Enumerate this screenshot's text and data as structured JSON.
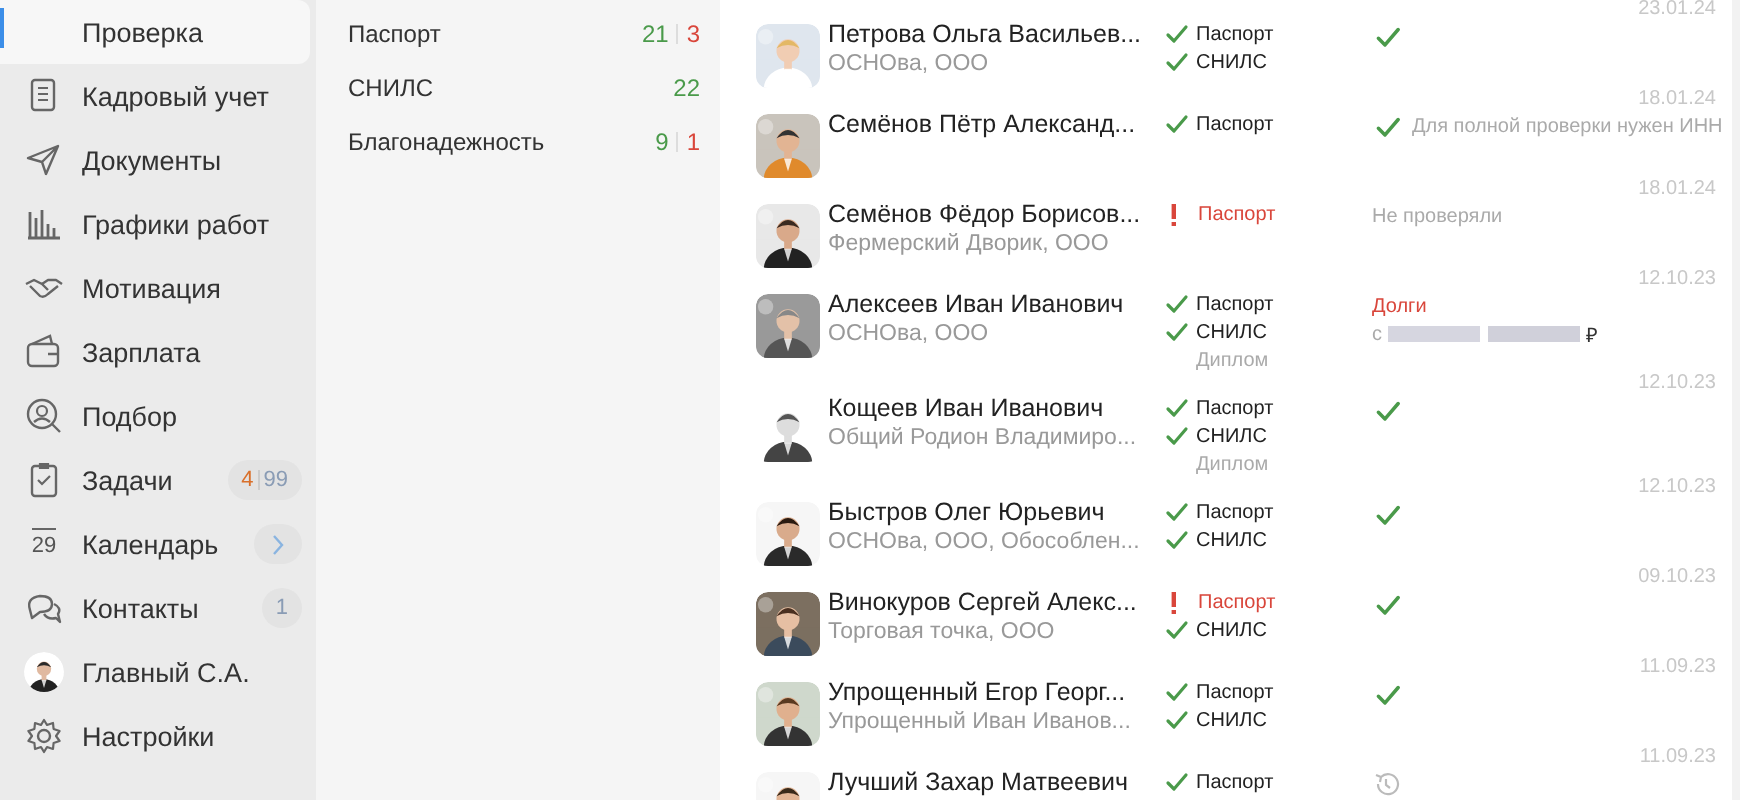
{
  "sidebar": {
    "items": [
      {
        "kind": "nav",
        "label": "Проверка",
        "selected": true
      },
      {
        "kind": "nav",
        "label": "Кадровый учет",
        "selected": false
      },
      {
        "kind": "nav",
        "label": "Документы",
        "selected": false
      },
      {
        "kind": "nav",
        "label": "Графики работ",
        "selected": false
      },
      {
        "kind": "nav",
        "label": "Мотивация",
        "selected": false
      },
      {
        "kind": "nav",
        "label": "Зарплата",
        "selected": false
      },
      {
        "kind": "nav",
        "label": "Подбор",
        "selected": false
      },
      {
        "kind": "nav",
        "label": "Задачи",
        "selected": false,
        "badge": {
          "count": "4",
          "total": "99"
        }
      },
      {
        "kind": "nav",
        "label": "Календарь",
        "selected": false,
        "icon_text": "29",
        "arrow": true
      },
      {
        "kind": "nav",
        "label": "Контакты",
        "selected": false,
        "badge": {
          "total": "1"
        }
      },
      {
        "kind": "profile",
        "label": "Главный С.А.",
        "selected": false
      },
      {
        "kind": "nav",
        "label": "Настройки",
        "selected": false
      }
    ]
  },
  "filters": [
    {
      "label": "Паспорт",
      "ok": "21",
      "bad": "3"
    },
    {
      "label": "СНИЛС",
      "ok": "22"
    },
    {
      "label": "Благонадежность",
      "ok": "9",
      "bad": "1"
    }
  ],
  "people": [
    {
      "date": "23.01.24",
      "name": "Петрова Ольга Васильев...",
      "org": "ОСНОва, ООО",
      "checks": [
        {
          "kind": "ok",
          "label": "Паспорт"
        },
        {
          "kind": "ok",
          "label": "СНИЛС"
        }
      ],
      "result": {
        "kind": "check"
      }
    },
    {
      "date": "18.01.24",
      "name": "Семёнов Пётр Александ...",
      "checks": [
        {
          "kind": "ok",
          "label": "Паспорт"
        }
      ],
      "result": {
        "kind": "check",
        "text": "Для полной проверки нужен ИНН"
      }
    },
    {
      "date": "18.01.24",
      "name": "Семёнов Фёдор Борисов...",
      "org": "Фермерский Дворик, ООО",
      "checks": [
        {
          "kind": "warn",
          "label": "Паспорт"
        }
      ],
      "result": {
        "kind": "text",
        "text": "Не проверяли"
      }
    },
    {
      "date": "12.10.23",
      "name": "Алексеев Иван Иванович",
      "org": "ОСНОва, ООО",
      "checks": [
        {
          "kind": "ok",
          "label": "Паспорт"
        },
        {
          "kind": "ok",
          "label": "СНИЛС"
        },
        {
          "kind": "note",
          "label": "Диплом"
        }
      ],
      "result": {
        "kind": "debt",
        "title": "Долги",
        "prefix": "с",
        "suffix": "₽"
      }
    },
    {
      "date": "12.10.23",
      "name": "Кощеев Иван Иванович",
      "org": "Общий Родион Владимиро...",
      "checks": [
        {
          "kind": "ok",
          "label": "Паспорт"
        },
        {
          "kind": "ok",
          "label": "СНИЛС"
        },
        {
          "kind": "note",
          "label": "Диплом"
        }
      ],
      "result": {
        "kind": "check"
      }
    },
    {
      "date": "12.10.23",
      "name": "Быстров Олег Юрьевич",
      "org": "ОСНОва, ООО, Обособлен...",
      "checks": [
        {
          "kind": "ok",
          "label": "Паспорт"
        },
        {
          "kind": "ok",
          "label": "СНИЛС"
        }
      ],
      "result": {
        "kind": "check"
      }
    },
    {
      "date": "09.10.23",
      "name": "Винокуров Сергей Алекс...",
      "org": "Торговая точка, ООО",
      "checks": [
        {
          "kind": "warn",
          "label": "Паспорт"
        },
        {
          "kind": "ok",
          "label": "СНИЛС"
        }
      ],
      "result": {
        "kind": "check"
      }
    },
    {
      "date": "11.09.23",
      "name": "Упрощенный Егор Георг...",
      "org": "Упрощенный Иван Иванов...",
      "checks": [
        {
          "kind": "ok",
          "label": "Паспорт"
        },
        {
          "kind": "ok",
          "label": "СНИЛС"
        }
      ],
      "result": {
        "kind": "check"
      }
    },
    {
      "date": "11.09.23",
      "name": "Лучший Захар Матвеевич",
      "checks": [
        {
          "kind": "ok",
          "label": "Паспорт"
        }
      ],
      "result": {
        "kind": "history"
      }
    }
  ]
}
